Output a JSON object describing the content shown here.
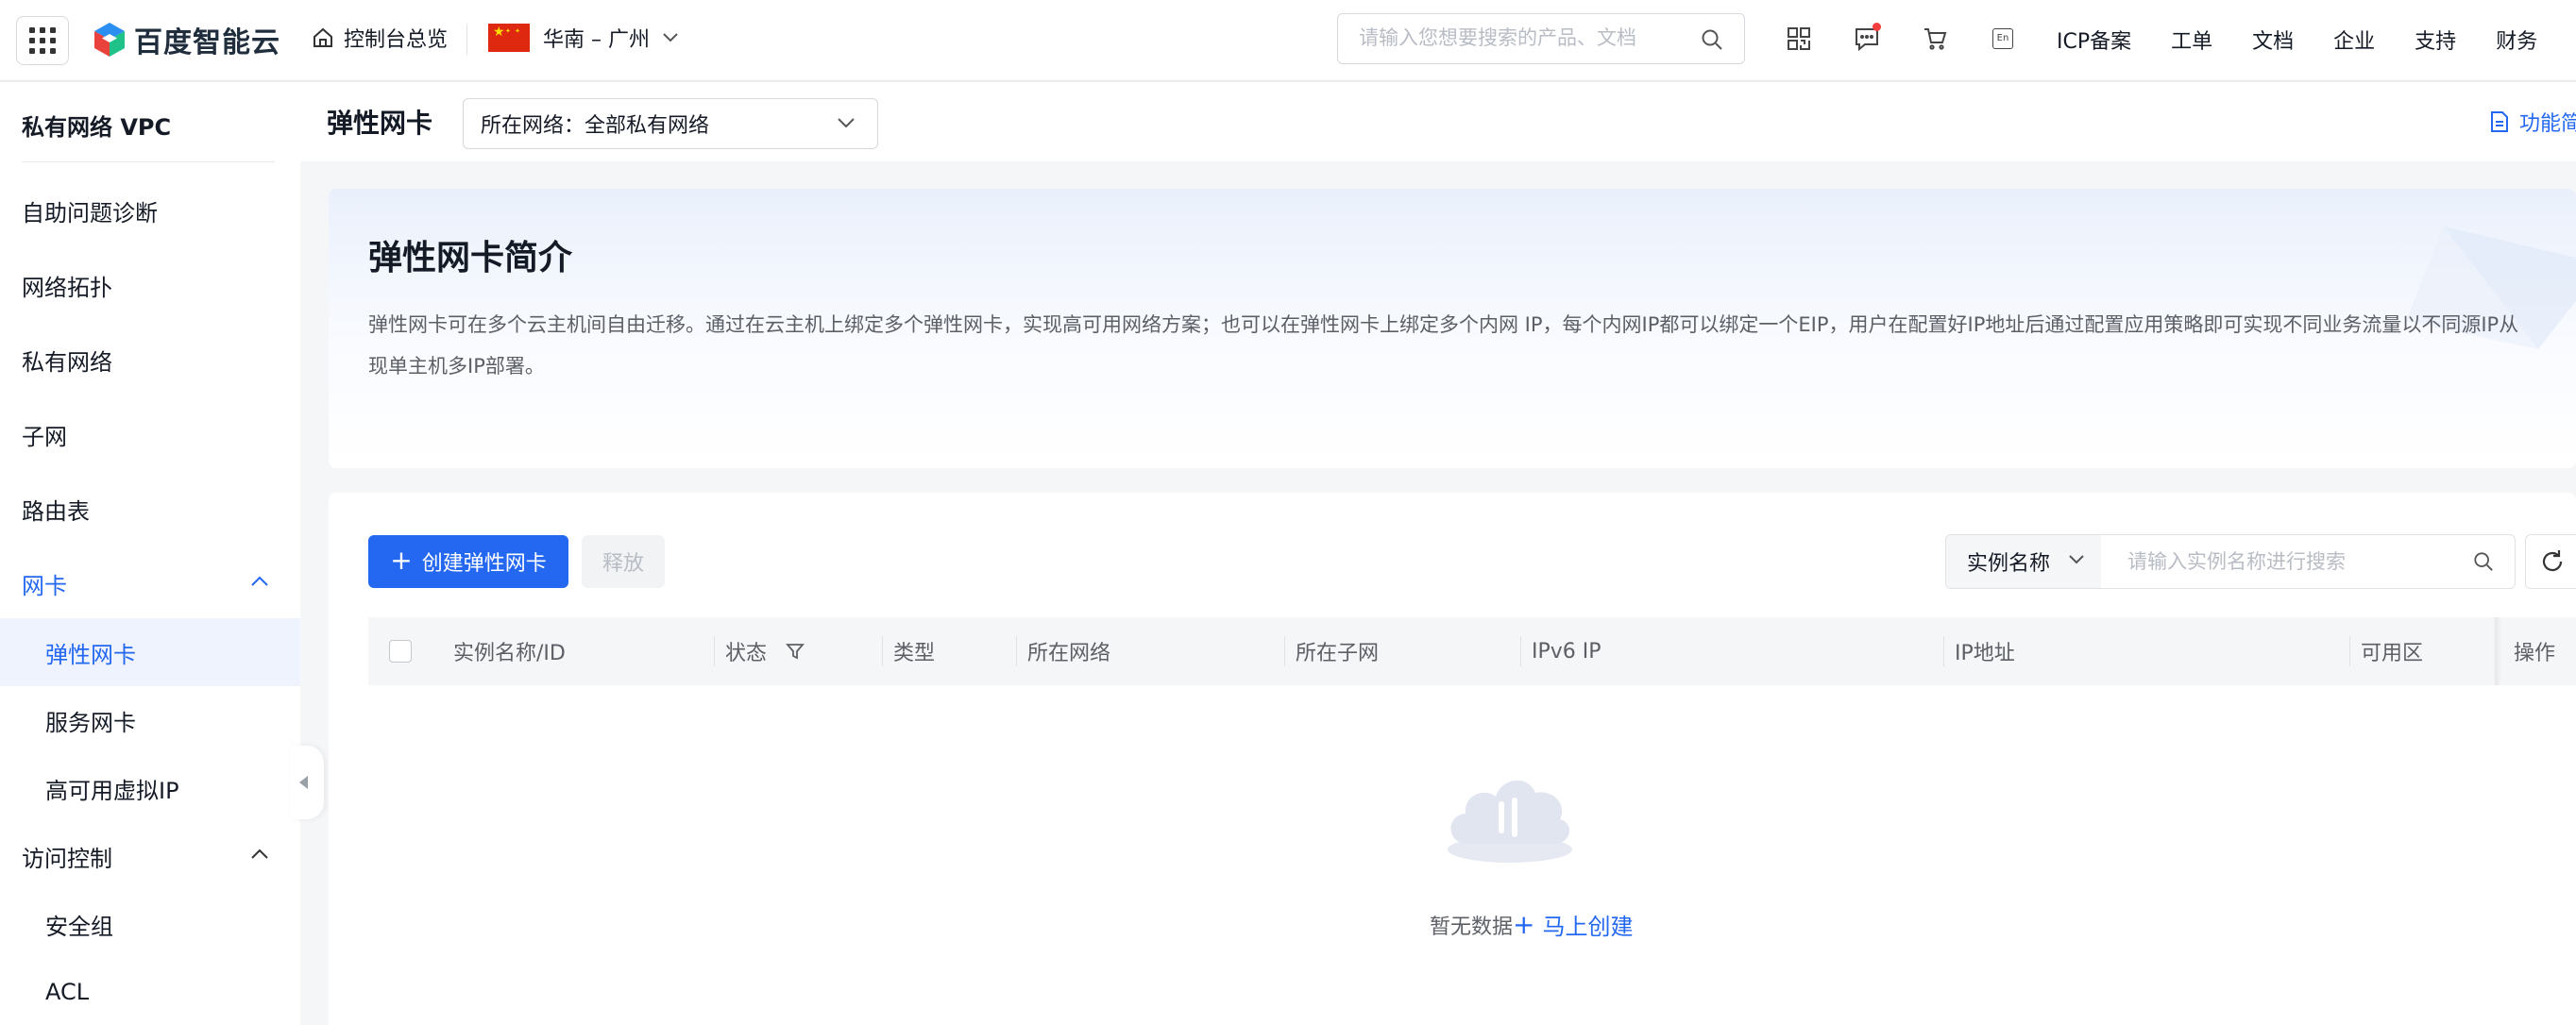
{
  "topbar": {
    "logo_text": "百度智能云",
    "console_label": "控制台总览",
    "region_label": "华南 – 广州",
    "search_placeholder": "请输入您想要搜索的产品、文档",
    "links": [
      "ICP备案",
      "工单",
      "文档",
      "企业",
      "支持",
      "财务"
    ]
  },
  "sidebar": {
    "title": "私有网络 VPC",
    "items": [
      {
        "label": "自助问题诊断"
      },
      {
        "label": "网络拓扑"
      },
      {
        "label": "私有网络"
      },
      {
        "label": "子网"
      },
      {
        "label": "路由表"
      },
      {
        "label": "网卡"
      },
      {
        "label": "弹性网卡"
      },
      {
        "label": "服务网卡"
      },
      {
        "label": "高可用虚拟IP"
      },
      {
        "label": "访问控制"
      },
      {
        "label": "安全组"
      },
      {
        "label": "ACL"
      }
    ]
  },
  "header": {
    "title": "弹性网卡",
    "network_select": "所在网络：全部私有网络",
    "func_link": "功能简"
  },
  "intro": {
    "title": "弹性网卡简介",
    "desc_line1": "弹性网卡可在多个云主机间自由迁移。通过在云主机上绑定多个弹性网卡，实现高可用网络方案；也可以在弹性网卡上绑定多个内网 IP，每个内网IP都可以绑定一个EIP，用户在配置好IP地址后通过配置应用策略即可实现不同业务流量以不同源IP从",
    "desc_line2": "现单主机多IP部署。"
  },
  "toolbar": {
    "create_label": "创建弹性网卡",
    "release_label": "释放",
    "search_type": "实例名称",
    "search_placeholder": "请输入实例名称进行搜索"
  },
  "table": {
    "columns": [
      "实例名称/ID",
      "状态",
      "类型",
      "所在网络",
      "所在子网",
      "IPv6 IP",
      "IP地址",
      "可用区",
      "操作"
    ]
  },
  "empty": {
    "text": "暂无数据",
    "link": "马上创建"
  },
  "colors": {
    "primary": "#2468f2",
    "text": "#151b26",
    "muted": "#5c5f66",
    "bg": "#f5f6f8"
  }
}
